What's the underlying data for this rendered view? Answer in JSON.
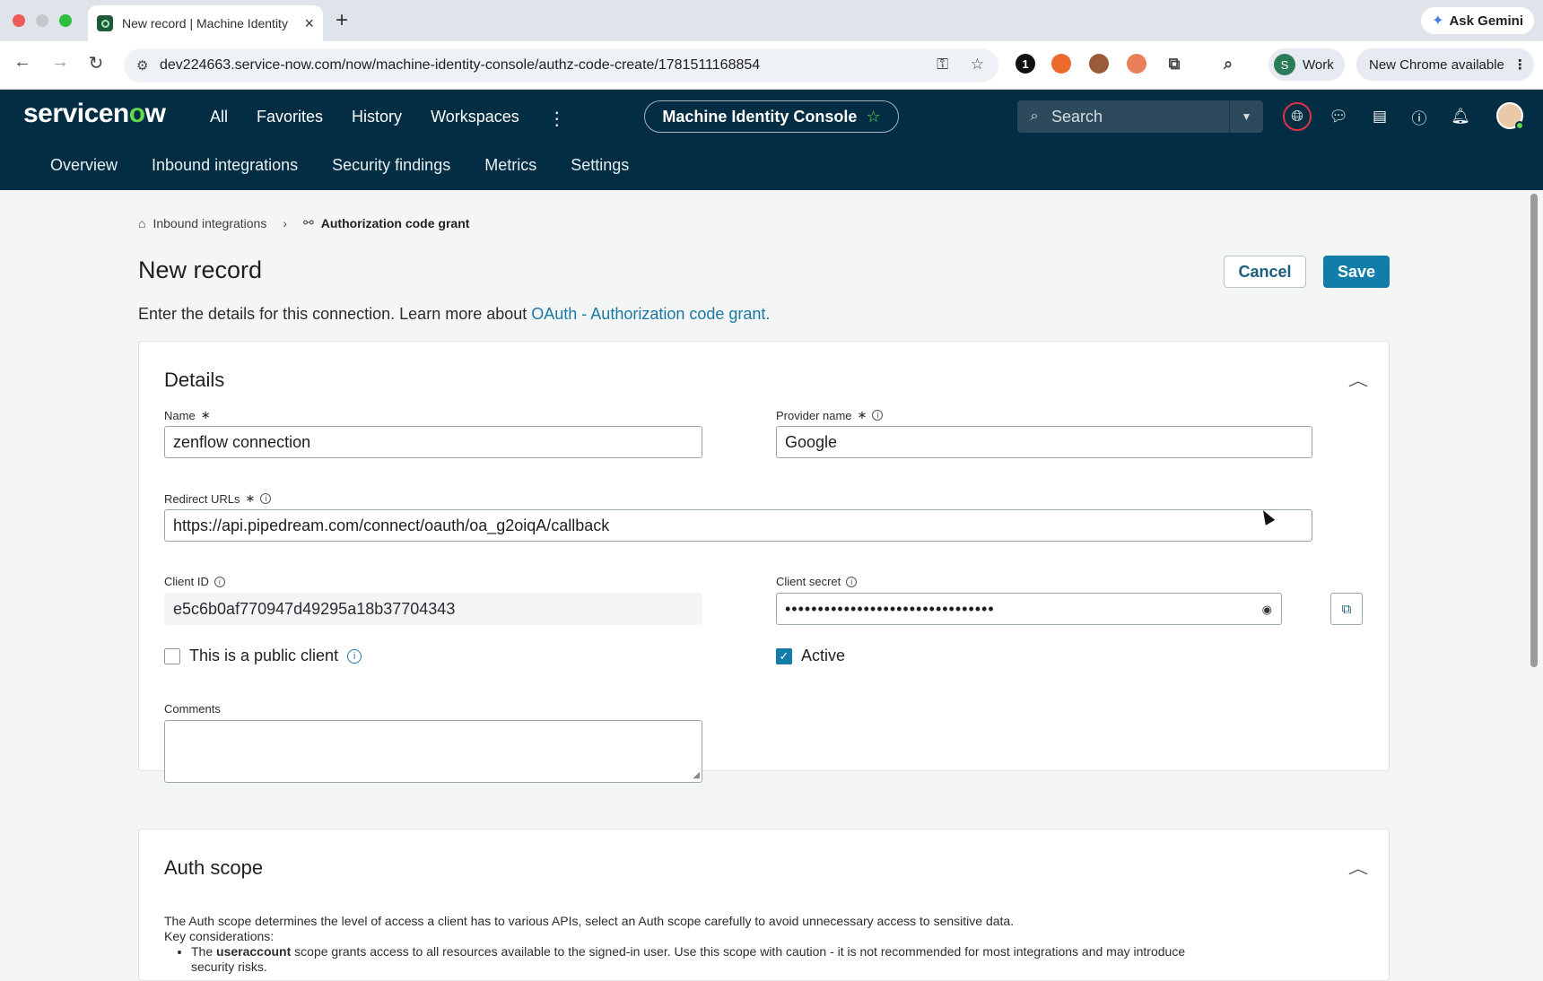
{
  "browser": {
    "tab_title": "New record | Machine Identity",
    "new_tab": "+",
    "ask_gemini": "Ask Gemini",
    "url": "dev224663.service-now.com/now/machine-identity-console/authz-code-create/1781511168854",
    "profile_initial": "S",
    "profile_label": "Work",
    "update_label": "New Chrome available",
    "ext_badge": "1"
  },
  "header": {
    "logo_pre": "servicen",
    "logo_o": "o",
    "logo_post": "w",
    "nav": [
      "All",
      "Favorites",
      "History",
      "Workspaces"
    ],
    "workspace_name": "Machine Identity Console",
    "search_placeholder": "Search",
    "subnav": [
      "Overview",
      "Inbound integrations",
      "Security findings",
      "Metrics",
      "Settings"
    ]
  },
  "breadcrumb": {
    "parent": "Inbound integrations",
    "current": "Authorization code grant"
  },
  "page": {
    "title": "New record",
    "cancel_label": "Cancel",
    "save_label": "Save",
    "intro_text": "Enter the details for this connection. Learn more about ",
    "intro_link": "OAuth - Authorization code grant."
  },
  "details": {
    "heading": "Details",
    "name_label": "Name",
    "name_value": "zenflow connection",
    "provider_label": "Provider name",
    "provider_value": "Google",
    "redirect_label": "Redirect URLs",
    "redirect_value": "https://api.pipedream.com/connect/oauth/oa_g2oiqA/callback",
    "client_id_label": "Client ID",
    "client_id_value": "e5c6b0af770947d49295a18b37704343",
    "client_secret_label": "Client secret",
    "client_secret_value": "••••••••••••••••••••••••••••••••",
    "public_client_label": "This is a public client",
    "public_client_checked": false,
    "active_label": "Active",
    "active_checked": true,
    "comments_label": "Comments",
    "required_mark": "∗"
  },
  "auth_scope": {
    "heading": "Auth scope",
    "description": "The Auth scope determines the level of access a client has to various APIs, select an Auth scope carefully to avoid unnecessary access to sensitive data.",
    "key_label": "Key considerations:",
    "bullet_pre": "The ",
    "bullet_bold": "useraccount",
    "bullet_post": " scope grants access to all resources available to the signed-in user. Use this scope with caution - it is not recommended for most integrations and may introduce",
    "bullet_cont": "security risks."
  },
  "colors": {
    "header_bg": "#032d42",
    "accent": "#117da8",
    "logo_green": "#62d84e"
  }
}
